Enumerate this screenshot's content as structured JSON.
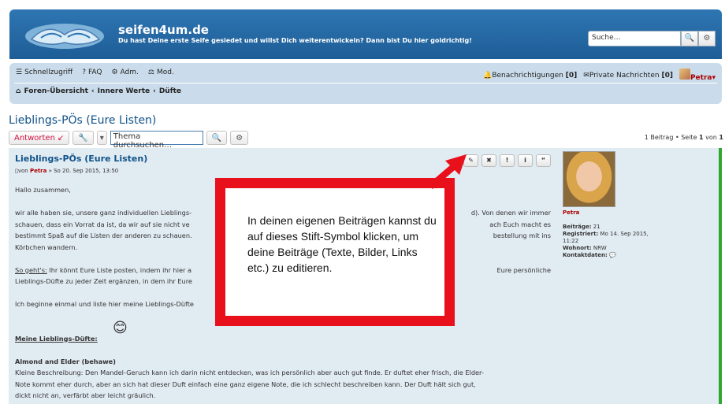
{
  "header": {
    "title": "seifen4um.de",
    "description": "Du hast Deine erste Seife gesiedet und willst Dich weiterentwickeln? Dann bist Du hier goldrichtig!",
    "search_placeholder": "Suche…",
    "search_icon": "magnifier-icon",
    "settings_icon": "gear-icon"
  },
  "nav": {
    "quick_links": "Schnellzugriff",
    "faq": "FAQ",
    "adm": "Adm.",
    "mod": "Mod.",
    "notifications": "Benachrichtigungen",
    "notifications_count": "[0]",
    "messages": "Private Nachrichten",
    "messages_count": "[0]",
    "user": "Petra"
  },
  "breadcrumb": [
    "Foren-Übersicht",
    "Innere Werte",
    "Düfte"
  ],
  "topic": {
    "title": "Lieblings-PÖs (Eure Listen)",
    "reply_button": "Antworten",
    "search_placeholder": "Thema durchsuchen…",
    "pagination_prefix": "1 Beitrag • Seite ",
    "page": "1",
    "of": " von ",
    "total": "1"
  },
  "post": {
    "title": "Lieblings-PÖs (Eure Listen)",
    "meta_prefix": "von ",
    "author": "Petra",
    "meta_date": " » So 20. Sep 2015, 13:50",
    "greeting": "Hallo zusammen,",
    "para1a": "wir alle haben sie, unsere ganz individuellen Lieblings-",
    "para1a_right": "d). Von denen wir immer",
    "para1b": "schauen, dass ein Vorrat da ist, da wir auf sie nicht ve",
    "para1b_right": "ach Euch macht es",
    "para1c": "bestimmt Spaß auf die Listen der anderen zu schauen.",
    "para1c_right": "bestellung mit ins",
    "para1d": "Körbchen wandern.",
    "sogehts_label": "So geht's:",
    "para2a": " Ihr könnt Eure Liste posten, indem ihr hier a",
    "para2a_right": "Eure persönliche",
    "para2b": "Lieblings-Düfte zu jeder Zeit ergänzen, in dem ihr Eure",
    "para3": "Ich beginne einmal und liste hier meine Lieblings-Düfte",
    "section_heading": "Meine Lieblings-Düfte:",
    "item_title": "Almond and Elder (behawe)",
    "item_desc1": "Kleine Beschreibung: Den Mandel-Geruch kann ich darin nicht entdecken, was ich persönlich aber auch gut finde. Er duftet eher frisch, die Elder-",
    "item_desc2": "Note kommt eher durch, aber an sich hat dieser Duft einfach eine ganz eigene Note, die ich schlecht beschreiben kann. Der Duft hält sich gut,",
    "item_desc3": "dickt nicht an, verfärbt aber leicht gräulich."
  },
  "post_buttons": [
    "✎",
    "✖",
    "!",
    "i",
    "“"
  ],
  "profile": {
    "username": "Petra",
    "posts_label": "Beiträge:",
    "posts": "21",
    "registered_label": "Registriert:",
    "registered": "Mo 14. Sep 2015, 11:22",
    "location_label": "Wohnort:",
    "location": "NRW",
    "contact_label": "Kontaktdaten:"
  },
  "callout": {
    "text": "In deinen eigenen Beiträgen kannst du auf dieses Stift-Symbol klicken, um deine Beiträge (Texte, Bilder, Links etc.) zu editieren."
  },
  "colors": {
    "header_blue": "#1e5d96",
    "nav_blue": "#cadceb",
    "post_bg": "#e1ebf2",
    "callout_red": "#e8101b",
    "username_red": "#aa0000",
    "link_blue": "#105289"
  }
}
